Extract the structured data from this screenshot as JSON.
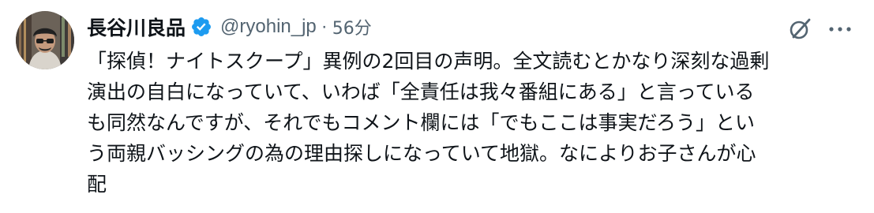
{
  "author": {
    "display_name": "長谷川良品",
    "handle": "@ryohin_jp",
    "separator": "·",
    "time": "56分",
    "verified_icon": "verified-badge-icon",
    "avatar_icon": "profile-avatar"
  },
  "actions": {
    "grok_icon": "grok-icon",
    "more_icon": "more-icon"
  },
  "tweet": {
    "lines": [
      "「探偵！ナイトスクープ」異例の2回目の声明。全文読むとかなり深刻な過剰",
      "演出の自白になっていて、いわば「全責任は我々番組にある」と言っている",
      "も同然なんですが、それでもコメント欄には「でもここは事実だろう」とい",
      "う両親バッシングの為の理由探しになっていて地獄。なによりお子さんが心",
      "配"
    ]
  },
  "colors": {
    "text": "#0f1419",
    "secondary": "#536471",
    "verified": "#1d9bf0"
  }
}
